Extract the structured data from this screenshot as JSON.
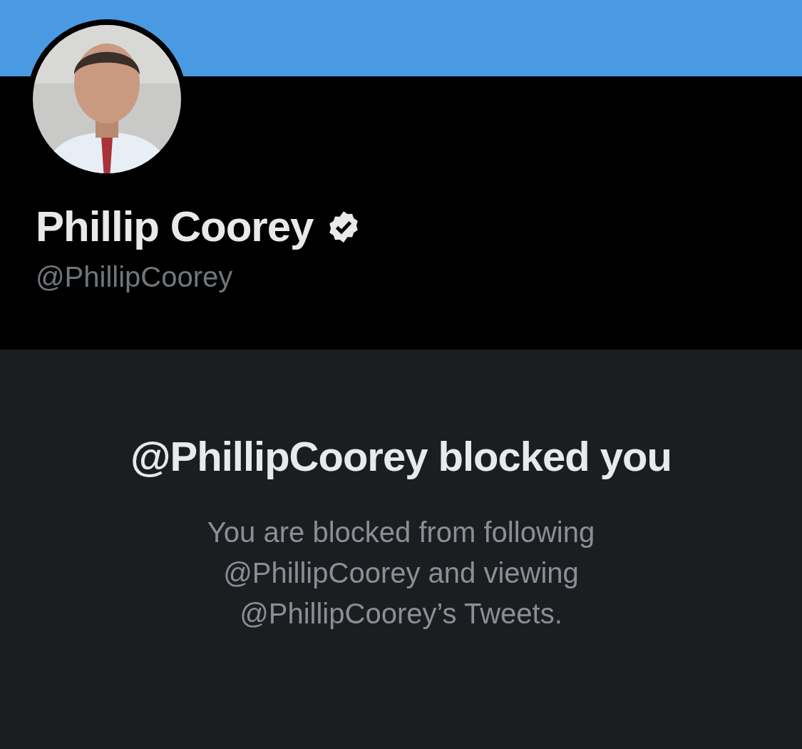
{
  "profile": {
    "name": "Phillip Coorey",
    "verified": true,
    "handle": "@PhillipCoorey"
  },
  "blocked_notice": {
    "title": "@PhillipCoorey blocked you",
    "message": "You are blocked from following @PhillipCoorey and viewing @PhillipCoorey’s Tweets."
  }
}
